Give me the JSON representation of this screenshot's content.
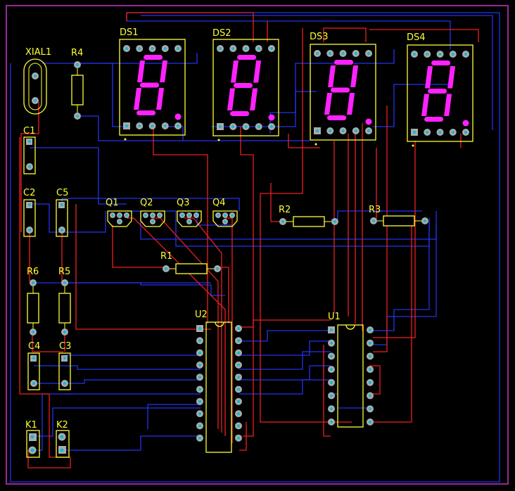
{
  "colors": {
    "background": "#000000",
    "board_outline": "#cc33cc",
    "silkscreen": "#ffff33",
    "top_trace": "#ff2020",
    "bottom_trace": "#2233ee",
    "pad": "#aaaaaa",
    "segment": "#ff22ff"
  },
  "components": {
    "xtal": "XIAL1",
    "r4": "R4",
    "c1": "C1",
    "c2": "C2",
    "c5": "C5",
    "r6": "R6",
    "r5": "R5",
    "c4": "C4",
    "c3": "C3",
    "k1": "K1",
    "k2": "K2",
    "q1": "Q1",
    "q2": "Q2",
    "q3": "Q3",
    "q4": "Q4",
    "r1": "R1",
    "r2": "R2",
    "r3": "R3",
    "u1": "U1",
    "u2": "U2",
    "ds1": "DS1",
    "ds2": "DS2",
    "ds3": "DS3",
    "ds4": "DS4"
  }
}
